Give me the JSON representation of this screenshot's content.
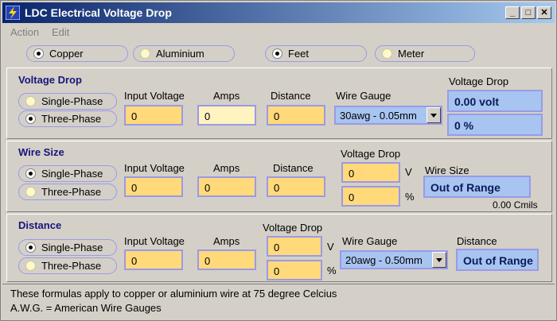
{
  "window": {
    "title": "LDC Electrical Voltage Drop",
    "buttons": {
      "minimize": "_",
      "maximize": "□",
      "close": "✕"
    }
  },
  "menu": {
    "items": [
      "Action",
      "Edit"
    ]
  },
  "options": {
    "material": [
      {
        "label": "Copper",
        "selected": true
      },
      {
        "label": "Aluminium",
        "selected": false
      }
    ],
    "unit": [
      {
        "label": "Feet",
        "selected": true
      },
      {
        "label": "Meter",
        "selected": false
      }
    ]
  },
  "voltage_drop": {
    "title": "Voltage Drop",
    "phase": [
      {
        "label": "Single-Phase",
        "selected": false
      },
      {
        "label": "Three-Phase",
        "selected": true
      }
    ],
    "labels": {
      "input_voltage": "Input Voltage",
      "amps": "Amps",
      "distance": "Distance",
      "wire_gauge": "Wire Gauge",
      "voltage_drop": "Voltage Drop"
    },
    "values": {
      "input_voltage": "0",
      "amps": "0",
      "distance": "0"
    },
    "wire_gauge": "30awg - 0.05mm",
    "result_volt": "0.00 volt",
    "result_pct": "0 %"
  },
  "wire_size": {
    "title": "Wire Size",
    "phase": [
      {
        "label": "Single-Phase",
        "selected": true
      },
      {
        "label": "Three-Phase",
        "selected": false
      }
    ],
    "labels": {
      "input_voltage": "Input Voltage",
      "amps": "Amps",
      "distance": "Distance",
      "voltage_drop": "Voltage Drop",
      "wire_size": "Wire Size",
      "unit_v": "V",
      "unit_pct": "%"
    },
    "values": {
      "input_voltage": "0",
      "amps": "0",
      "distance": "0",
      "drop_v": "0",
      "drop_pct": "0"
    },
    "result": "Out of Range",
    "cmils": "0.00 Cmils"
  },
  "distance": {
    "title": "Distance",
    "phase": [
      {
        "label": "Single-Phase",
        "selected": true
      },
      {
        "label": "Three-Phase",
        "selected": false
      }
    ],
    "labels": {
      "input_voltage": "Input Voltage",
      "amps": "Amps",
      "voltage_drop": "Voltage Drop",
      "wire_gauge": "Wire Gauge",
      "distance": "Distance",
      "unit_v": "V",
      "unit_pct": "%"
    },
    "values": {
      "input_voltage": "0",
      "amps": "0",
      "drop_v": "0",
      "drop_pct": "0"
    },
    "wire_gauge": "20awg - 0.50mm",
    "result": "Out of Range"
  },
  "footer": {
    "line1": "These formulas apply to copper or aluminium  wire at 75 degree Celcius",
    "line2": "A.W.G. = American Wire Gauges"
  }
}
